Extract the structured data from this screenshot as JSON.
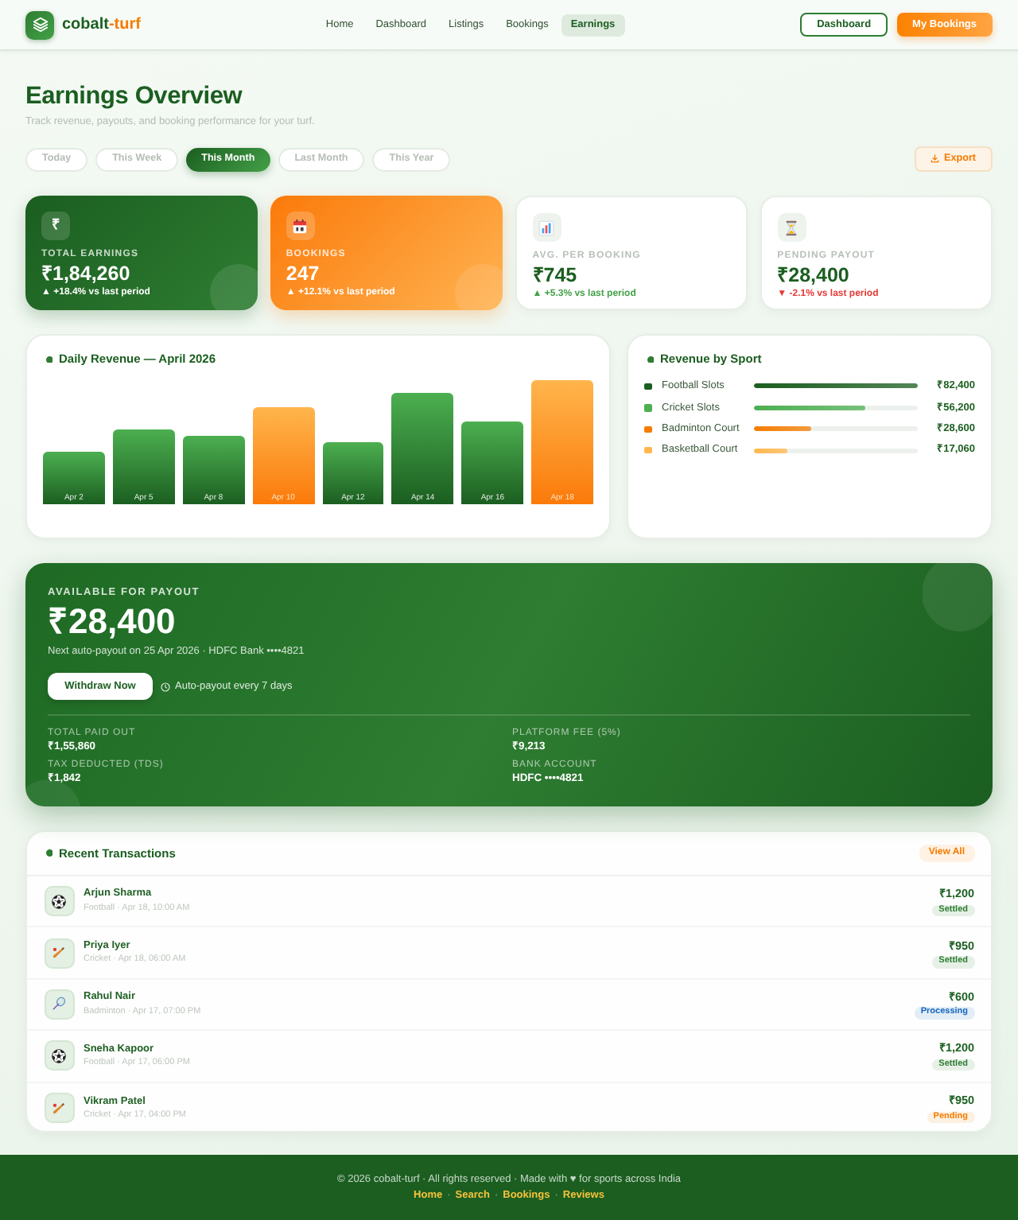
{
  "header": {
    "brand": {
      "name": "cobalt",
      "accent": "-turf"
    },
    "nav": [
      {
        "label": "Home",
        "selected": false
      },
      {
        "label": "Dashboard",
        "selected": false
      },
      {
        "label": "Listings",
        "selected": false
      },
      {
        "label": "Bookings",
        "selected": false
      },
      {
        "label": "Earnings",
        "selected": true
      }
    ],
    "actions": [
      {
        "label": "Dashboard",
        "kind": "outline"
      },
      {
        "label": "My Bookings",
        "kind": "filled"
      }
    ]
  },
  "page": {
    "title": "Earnings Overview",
    "subtitle": "Track revenue, payouts, and booking performance for your turf."
  },
  "period_tabs": [
    {
      "label": "Today",
      "selected": false
    },
    {
      "label": "This Week",
      "selected": false
    },
    {
      "label": "This Month",
      "selected": true
    },
    {
      "label": "Last Month",
      "selected": false
    },
    {
      "label": "This Year",
      "selected": false
    }
  ],
  "export_button": {
    "label": "Export"
  },
  "stats": [
    {
      "kind": "primary",
      "symbol": "₹",
      "label": "TOTAL EARNINGS",
      "value": "₹1,84,260",
      "change": "▲ +18.4% vs last period",
      "rising": true
    },
    {
      "kind": "accent",
      "label": "BOOKINGS",
      "value": "247",
      "change": "▲ +12.1% vs last period",
      "rising": true
    },
    {
      "kind": "plain",
      "label": "AVG. PER BOOKING",
      "value": "₹745",
      "change": "▲ +5.3% vs last period",
      "rising": true
    },
    {
      "kind": "plain",
      "label": "PENDING PAYOUT",
      "value": "₹28,400",
      "change": "▼ -2.1% vs last period",
      "rising": false
    }
  ],
  "daily_revenue": {
    "title": "Daily Revenue — April 2026",
    "bars": [
      {
        "label": "Apr 2",
        "highlighted": false
      },
      {
        "label": "Apr 5",
        "highlighted": false
      },
      {
        "label": "Apr 8",
        "highlighted": false
      },
      {
        "label": "Apr 10",
        "highlighted": true
      },
      {
        "label": "Apr 12",
        "highlighted": false
      },
      {
        "label": "Apr 14",
        "highlighted": false
      },
      {
        "label": "Apr 16",
        "highlighted": false
      },
      {
        "label": "Apr 18",
        "highlighted": true
      }
    ]
  },
  "revenue_by_sport": {
    "title": "Revenue by Sport",
    "items": [
      {
        "name": "Football Slots",
        "color": "#1b5e20",
        "level": 1,
        "amount": "₹82,400"
      },
      {
        "name": "Cricket Slots",
        "color": "#4caf50",
        "level": 0.68,
        "amount": "₹56,200"
      },
      {
        "name": "Badminton Court",
        "color": "#f57c00",
        "level": 0.35,
        "amount": "₹28,600"
      },
      {
        "name": "Basketball Court",
        "color": "#ffb74d",
        "level": 0.21,
        "amount": "₹17,060"
      }
    ]
  },
  "payout": {
    "label": "AVAILABLE FOR PAYOUT",
    "amount": "₹28,400",
    "note": "Next auto-payout on 25 Apr 2026 · HDFC Bank ••••4821",
    "button": "Withdraw Now",
    "schedule": "Auto-payout every 7 days",
    "details": [
      {
        "label": "TOTAL PAID OUT",
        "value": "₹1,55,860"
      },
      {
        "label": "PLATFORM FEE (5%)",
        "value": "₹9,213"
      },
      {
        "label": "TAX DEDUCTED (TDS)",
        "value": "₹1,842"
      },
      {
        "label": "BANK ACCOUNT",
        "value": "HDFC ••••4821"
      }
    ]
  },
  "transactions": {
    "title": "Recent Transactions",
    "view_all": "View All",
    "rows": [
      {
        "kind": "football",
        "name": "Arjun Sharma",
        "detail": "Football · Apr 18, 10:00 AM",
        "amount": "₹1,200",
        "status": "Settled",
        "color": "#2e7d32"
      },
      {
        "kind": "cricket",
        "name": "Priya Iyer",
        "detail": "Cricket · Apr 18, 06:00 AM",
        "amount": "₹950",
        "status": "Settled",
        "color": "#2e7d32"
      },
      {
        "kind": "badminton",
        "name": "Rahul Nair",
        "detail": "Badminton · Apr 17, 07:00 PM",
        "amount": "₹600",
        "status": "Processing",
        "color": "#1565c0"
      },
      {
        "kind": "football",
        "name": "Sneha Kapoor",
        "detail": "Football · Apr 17, 06:00 PM",
        "amount": "₹1,200",
        "status": "Settled",
        "color": "#2e7d32"
      },
      {
        "kind": "cricket",
        "name": "Vikram Patel",
        "detail": "Cricket · Apr 17, 04:00 PM",
        "amount": "₹950",
        "status": "Pending",
        "color": "#f57c00"
      }
    ]
  },
  "footer": {
    "text": "© 2026 cobalt-turf · All rights reserved · Made with ♥ for sports across India",
    "links": [
      "Home",
      "Search",
      "Bookings",
      "Reviews"
    ],
    "separator": "·"
  }
}
